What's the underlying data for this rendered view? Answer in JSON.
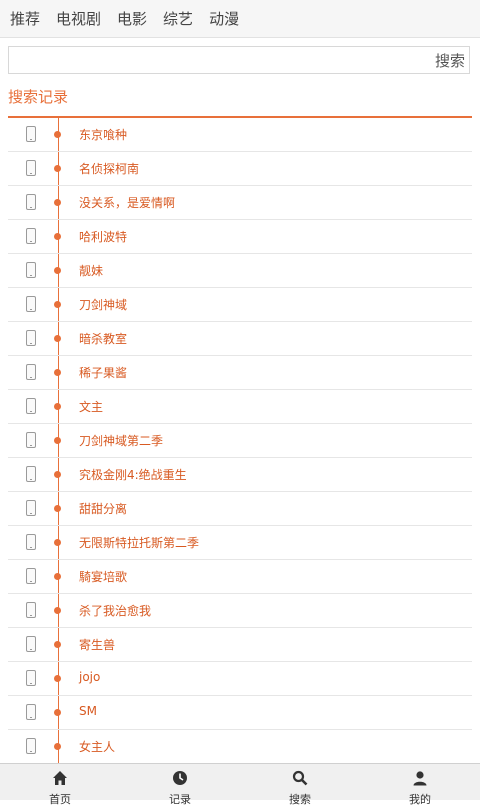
{
  "top_nav": {
    "tabs": [
      "推荐",
      "电视剧",
      "电影",
      "综艺",
      "动漫"
    ]
  },
  "search": {
    "value": "",
    "button_label": "搜索"
  },
  "history": {
    "title": "搜索记录",
    "items": [
      "东京喰种",
      "名侦探柯南",
      "没关系，是爱情啊",
      "哈利波特",
      "靓妹",
      "刀剑神域",
      "暗杀教室",
      "稀子果酱",
      "文主",
      "刀剑神域第二季",
      "究极金刚4:绝战重生",
      "甜甜分离",
      "无限斯特拉托斯第二季",
      "騎宴培歌",
      "杀了我治愈我",
      "寄生兽",
      "jojo",
      "SM",
      "女主人"
    ]
  },
  "bottom_nav": {
    "items": [
      {
        "label": "首页",
        "icon": "home-icon"
      },
      {
        "label": "记录",
        "icon": "clock-icon"
      },
      {
        "label": "搜索",
        "icon": "search-icon"
      },
      {
        "label": "我的",
        "icon": "user-icon"
      }
    ]
  },
  "colors": {
    "accent": "#e8703a",
    "link": "#d85a22"
  }
}
